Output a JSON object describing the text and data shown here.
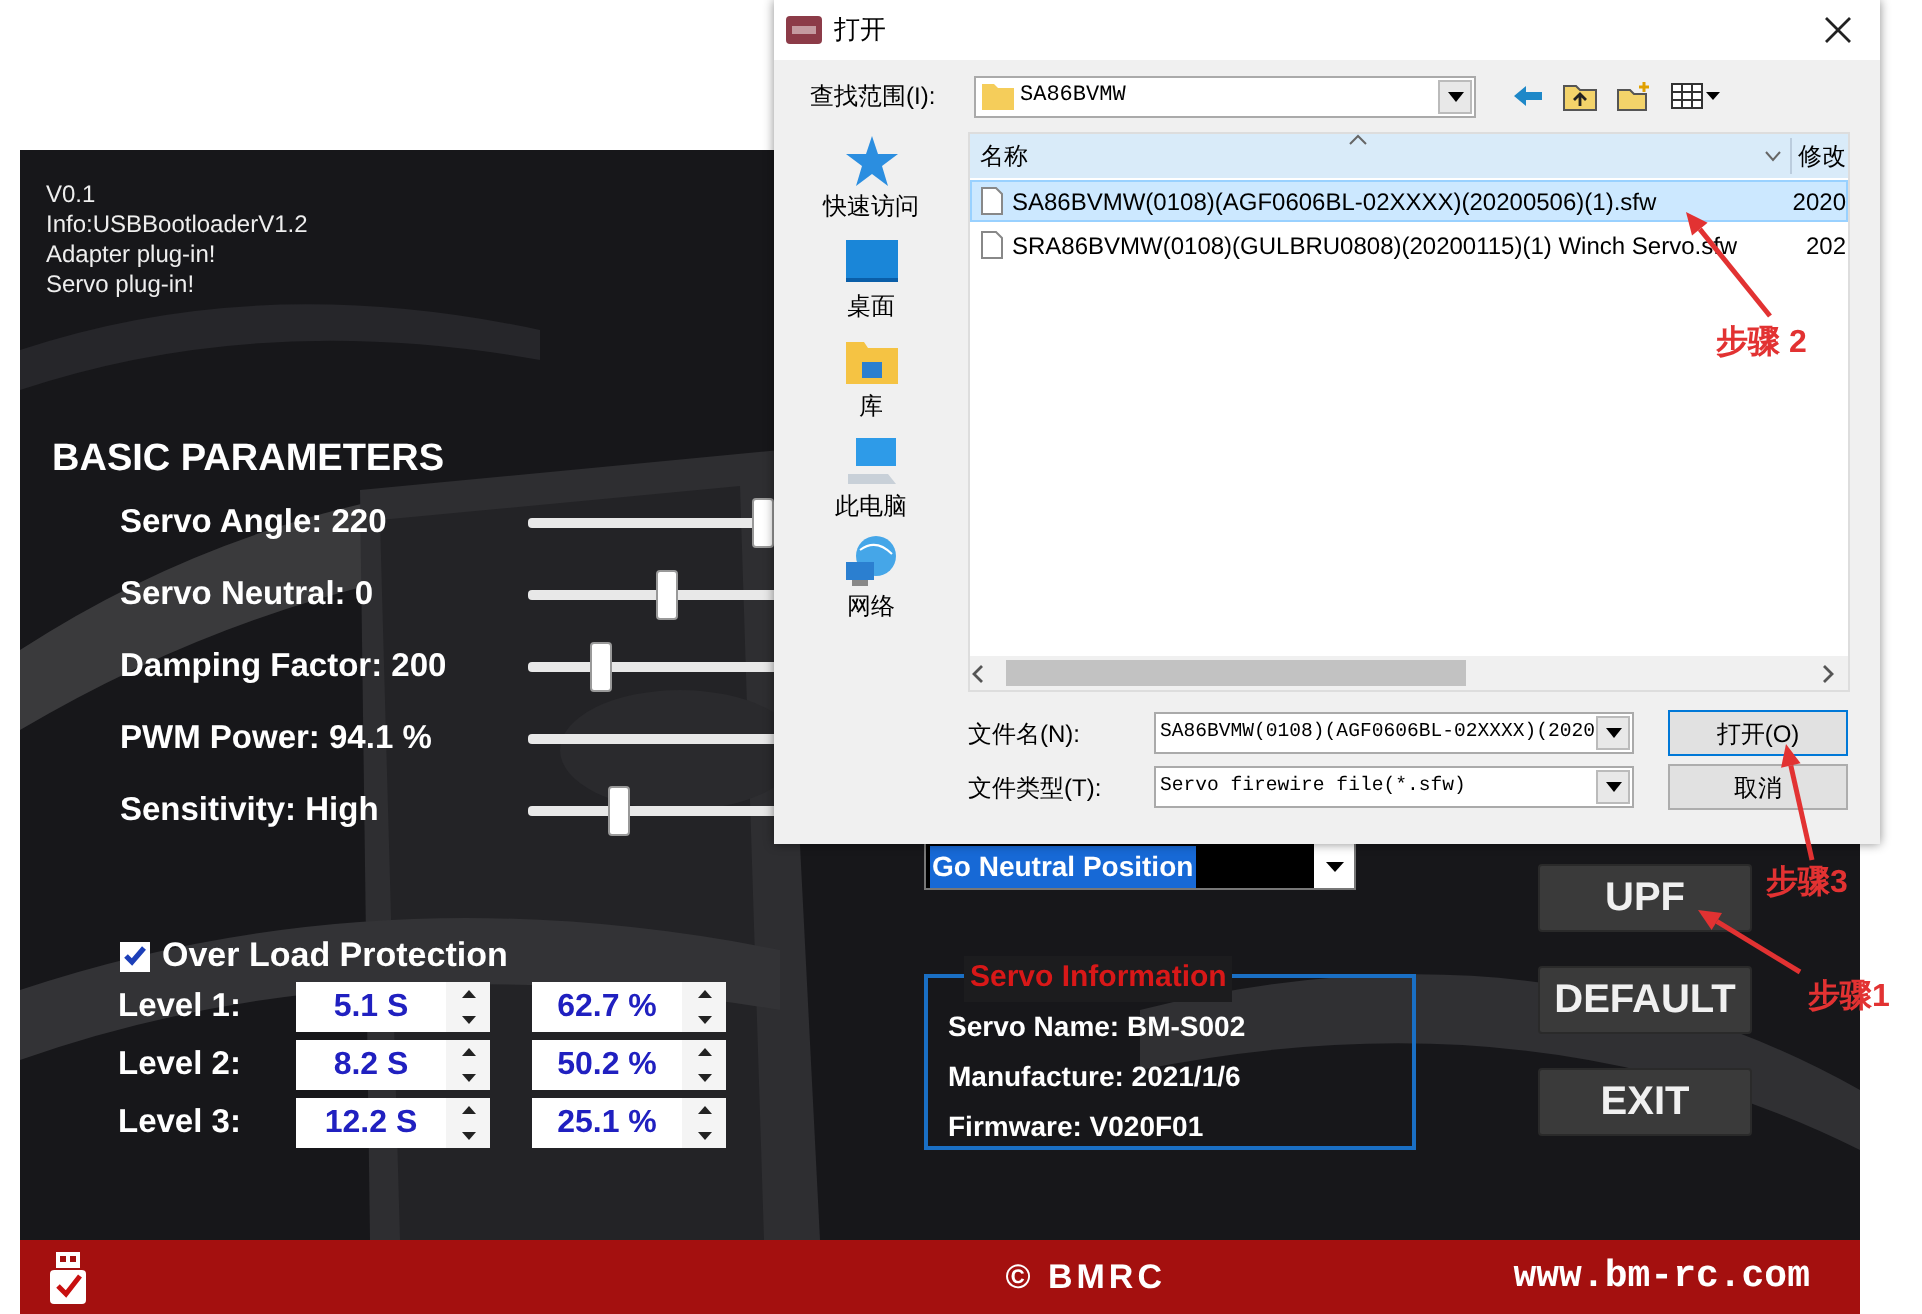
{
  "app": {
    "info_lines": [
      "V0.1",
      "Info:USBBootloaderV1.2",
      "Adapter plug-in!",
      "Servo plug-in!"
    ],
    "section_title": "BASIC PARAMETERS",
    "parameters": [
      {
        "label": "Servo Angle: 220",
        "level": 0.59
      },
      {
        "label": "Servo Neutral: 0",
        "level": 0.345
      },
      {
        "label": "Damping Factor: 200",
        "level": 0.18
      },
      {
        "label": "PWM Power: 94.1 %"
      },
      {
        "label": "Sensitivity: High",
        "level": 0.225
      }
    ],
    "action_dropdown": {
      "value": "Go Neutral Position"
    },
    "overload": {
      "label": "Over Load Protection",
      "checked": true,
      "levels": [
        {
          "label": "Level 1:",
          "time": "5.1 S",
          "percent": "62.7 %"
        },
        {
          "label": "Level 2:",
          "time": "8.2 S",
          "percent": "50.2 %"
        },
        {
          "label": "Level 3:",
          "time": "12.2 S",
          "percent": "25.1 %"
        }
      ]
    },
    "servo_info": {
      "title": "Servo Information",
      "lines": [
        "Servo Name: BM-S002",
        "Manufacture: 2021/1/6",
        "Firmware: V020F01"
      ]
    },
    "buttons": [
      "UPF",
      "DEFAULT",
      "EXIT"
    ],
    "footer": {
      "copyright": "© BMRC",
      "website": "www.bm-rc.com"
    }
  },
  "dialog": {
    "title": "打开",
    "look_in_label": "查找范围(I):",
    "look_in_value": "SA86BVMW",
    "places": [
      {
        "label": "快速访问",
        "kind": "star"
      },
      {
        "label": "桌面",
        "kind": "desktop"
      },
      {
        "label": "库",
        "kind": "library"
      },
      {
        "label": "此电脑",
        "kind": "computer"
      },
      {
        "label": "网络",
        "kind": "network"
      }
    ],
    "columns": [
      "名称",
      "修改"
    ],
    "files": [
      {
        "name": "SA86BVMW(0108)(AGF0606BL-02XXXX)(20200506)(1).sfw",
        "modified": "2020",
        "selected": true
      },
      {
        "name": "SRA86BVMW(0108)(GULBRU0808)(20200115)(1) Winch Servo.sfw",
        "modified": "202",
        "selected": false
      }
    ],
    "file_name_label": "文件名(N):",
    "file_name_value": "SA86BVMW(0108)(AGF0606BL-02XXXX)(2020",
    "file_type_label": "文件类型(T):",
    "file_type_value": "Servo firewire file(*.sfw)",
    "buttons": [
      "打开(O)",
      "取消"
    ]
  },
  "annotations": [
    {
      "label": "步骤 2"
    },
    {
      "label": "步骤3"
    },
    {
      "label": "步骤1"
    }
  ]
}
